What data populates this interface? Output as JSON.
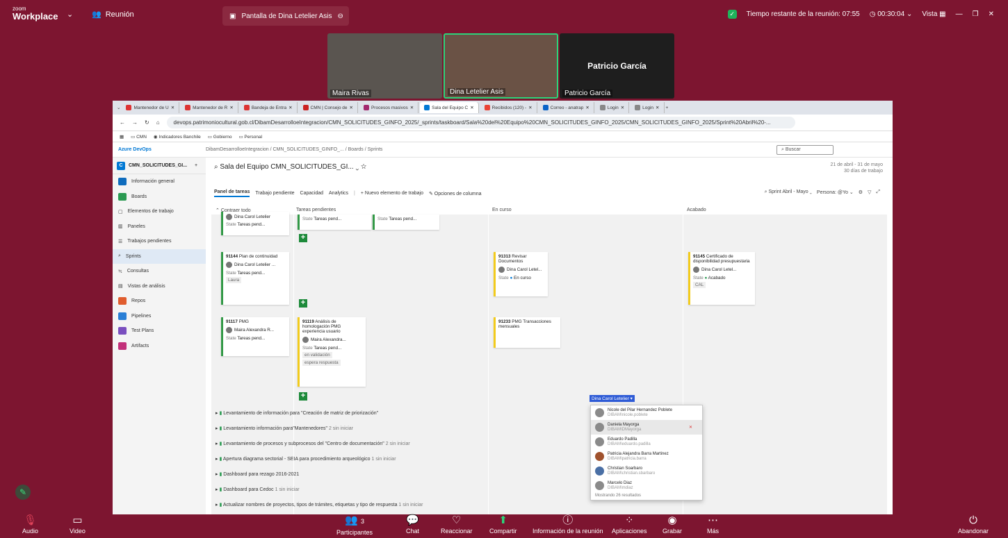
{
  "zoom": {
    "logo_top": "zoom",
    "logo_bottom": "Workplace",
    "meeting_label": "Reunión",
    "share_tab": "Pantalla de Dina Letelier Asis",
    "time_remaining": "Tiempo restante de la reunión: 07:55",
    "elapsed": "00:30:04",
    "view": "Vista"
  },
  "participants_video": [
    {
      "name": "Maira Rivas"
    },
    {
      "name": "Dina Letelier Asis"
    },
    {
      "name": "Patricio García",
      "big": "Patricio García"
    }
  ],
  "browser": {
    "tabs": [
      "Mantenedor de U",
      "Mantenedor de R",
      "Bandeja de Entra",
      "CMN | Consejo de",
      "Procesos masivos",
      "Sala del Equipo C",
      "Recibidos (120) -",
      "Correo - anatrap",
      "Login",
      "Login"
    ],
    "url": "devops.patrimoniocultural.gob.cl/DibamDesarrolloeIntegracion/CMN_SOLICITUDES_GINFO_2025/_sprints/taskboard/Sala%20del%20Equipo%20CMN_SOLICITUDES_GINFO_2025/CMN_SOLICITUDES_GINFO_2025/Sprint%20Abril%20-...",
    "bookmarks": [
      "CMN",
      "Indicadores Banchile",
      "Gobierno",
      "Personal"
    ]
  },
  "devops": {
    "brand": "Azure DevOps",
    "breadcrumb": "DibamDesarrolloeIntegracion  /  CMN_SOLICITUDES_GINFO_...  /  Boards  /  Sprints",
    "search_placeholder": "Buscar",
    "project": "CMN_SOLICITUDES_GI...",
    "sidebar": [
      "Información general",
      "Boards",
      "Elementos de trabajo",
      "Paneles",
      "Trabajos pendientes",
      "Sprints",
      "Consultas",
      "Vistas de análisis",
      "Repos",
      "Pipelines",
      "Test Plans",
      "Artifacts"
    ],
    "title": "Sala del Equipo CMN_SOLICITUDES_GI...",
    "date_range": "21 de abril - 31 de mayo",
    "work_days": "30 días de trabajo",
    "pivots": [
      "Panel de tareas",
      "Trabajo pendiente",
      "Capacidad",
      "Analytics"
    ],
    "new_item": "Nuevo elemento de trabajo",
    "col_options": "Opciones de columna",
    "filters": [
      "Sprint Abril - Mayo",
      "Persona: @Yo"
    ],
    "columns": [
      "Contraer todo",
      "Tareas pendientes",
      "En curso",
      "Acabado"
    ],
    "cards": {
      "c91144": {
        "id": "91144",
        "title": "Plan de continuidad",
        "assignee": "Dina Carol Letelier ...",
        "state_label": "State",
        "state": "Tareas pend...",
        "tag": "Laura"
      },
      "c91313": {
        "id": "91313",
        "title": "Revisar Documentos",
        "assignee": "Dina Carol Letel...",
        "state_label": "State",
        "state": "En curso"
      },
      "c91145": {
        "id": "91145",
        "title": "Certificado de disponibilidad presupuestaria",
        "assignee": "Dina Carol Letel...",
        "state_label": "State",
        "state": "Acabado",
        "tag": "CAL"
      },
      "c91117": {
        "id": "91117",
        "title": "PMG",
        "assignee": "Maira Alexandra R...",
        "state_label": "State",
        "state": "Tareas pend..."
      },
      "c91119": {
        "id": "91119",
        "title": "Análisis de homologación PMG experiencia usuario",
        "assignee": "Maira Alexandra...",
        "state_label": "State",
        "state": "Tareas pend...",
        "tag1": "en validación",
        "tag2": "espera respuesta"
      },
      "c91233": {
        "id": "91233",
        "title": "PMG Transacciones mensuales",
        "assignee_edit": "Dina Carol Letelier"
      }
    },
    "top_card_name": "Dina Carol Letelier",
    "top_state_label": "State",
    "top_state": "Tareas pend...",
    "dropdown": [
      {
        "name": "Nicole del Pilar Hernandez Poblete",
        "user": "DIBAM\\nicole.poblete"
      },
      {
        "name": "Daniela Mayorga",
        "user": "DIBAM\\DMayorga"
      },
      {
        "name": "Eduardo Padilla",
        "user": "DIBAM\\eduardo.padilla"
      },
      {
        "name": "Patricia Alejandra Barra Martinez",
        "user": "DIBAM\\patricia.barra"
      },
      {
        "name": "Christian Soarbaro",
        "user": "DIBAM\\christian.sbarbaro"
      },
      {
        "name": "Marcelo Diaz",
        "user": "DIBAM\\mdiaz"
      }
    ],
    "dropdown_footer": "Mostrando 26 resultados",
    "rows": [
      {
        "title": "Levantamiento de información para \"Creación de matriz de priorización\"",
        "meta": ""
      },
      {
        "title": "Levantamiento información para\"Mantenedores\"",
        "meta": "2 sin iniciar"
      },
      {
        "title": "Levantamiento de procesos y subprocesos del \"Centro de documentación\"",
        "meta": "2 sin iniciar"
      },
      {
        "title": "Apertura diagrama sectorial - SEIA para procedimiento arqueológico",
        "meta": "1 sin iniciar"
      },
      {
        "title": "Dashboard para rezago 2016-2021",
        "meta": ""
      },
      {
        "title": "Dashboard para Cedoc",
        "meta": "1 sin iniciar"
      },
      {
        "title": "Actualizar nombres de proyectos, tipos de trámites, etiquetas y tipo de respuesta",
        "meta": "1 sin iniciar"
      }
    ]
  },
  "controls": {
    "audio": "Audio",
    "video": "Video",
    "participants": "Participantes",
    "participants_count": "3",
    "chat": "Chat",
    "react": "Reaccionar",
    "share": "Compartir",
    "info": "Información de la reunión",
    "apps": "Aplicaciones",
    "record": "Grabar",
    "more": "Más",
    "leave": "Abandonar"
  }
}
